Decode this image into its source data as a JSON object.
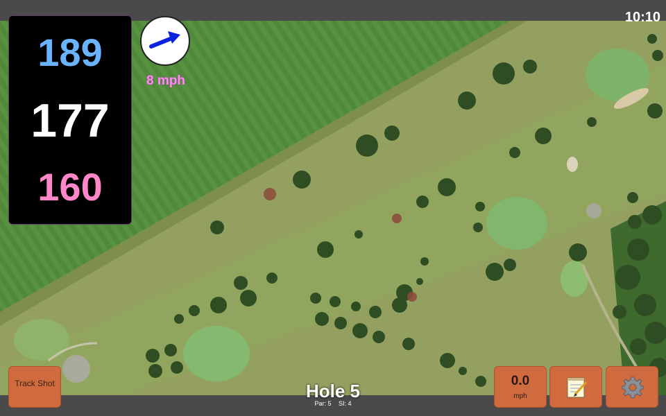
{
  "status": {
    "time": "10:10"
  },
  "distances": {
    "back": "189",
    "middle": "177",
    "front": "160"
  },
  "wind": {
    "speed_label": "8 mph",
    "arrow_color": "#0a22e0"
  },
  "buttons": {
    "track_shot_label": "Track Shot"
  },
  "speed": {
    "value": "0.0",
    "unit": "mph"
  },
  "hole": {
    "title": "Hole 5",
    "par_label": "Par: 5",
    "si_label": "SI: 4"
  },
  "icons": {
    "notes": "notepad-icon",
    "settings": "gear-icon",
    "wind": "wind-arrow-icon"
  },
  "colors": {
    "back_distance": "#6ab4ff",
    "front_distance": "#ff86c8",
    "button": "#d06a3f"
  }
}
